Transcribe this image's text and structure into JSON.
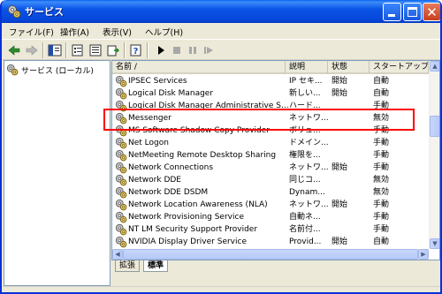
{
  "window": {
    "title": "サービス",
    "accent": "#0b54e5",
    "close_color": "#c7401b"
  },
  "menu": [
    {
      "label": "ファイル(F)"
    },
    {
      "label": "操作(A)"
    },
    {
      "label": "表示(V)"
    },
    {
      "label": "ヘルプ(H)"
    }
  ],
  "toolbar": {
    "icons": [
      "back-arrow-icon",
      "forward-arrow-icon",
      "console-tree-icon",
      "properties-icon",
      "export-list-icon",
      "help-icon",
      "start-service-icon",
      "stop-service-icon",
      "pause-service-icon",
      "restart-service-icon"
    ]
  },
  "tree": {
    "root_label": "サービス (ローカル)"
  },
  "table": {
    "columns": [
      "名前 /",
      "説明",
      "状態",
      "スタートアップの種類"
    ],
    "rows": [
      {
        "name": "IPSEC Services",
        "desc": "IP セキ...",
        "state": "開始",
        "startup": "自動"
      },
      {
        "name": "Logical Disk Manager",
        "desc": "新しい...",
        "state": "開始",
        "startup": "自動"
      },
      {
        "name": "Logical Disk Manager Administrative S...",
        "desc": "ハード...",
        "state": "",
        "startup": "手動"
      },
      {
        "name": "Messenger",
        "desc": "ネットワ...",
        "state": "",
        "startup": "無効"
      },
      {
        "name": "MS Software Shadow Copy Provider",
        "desc": "ボリュ...",
        "state": "",
        "startup": "手動"
      },
      {
        "name": "Net Logon",
        "desc": "ドメイン...",
        "state": "",
        "startup": "手動"
      },
      {
        "name": "NetMeeting Remote Desktop Sharing",
        "desc": "権限を...",
        "state": "",
        "startup": "手動"
      },
      {
        "name": "Network Connections",
        "desc": "ネットワ...",
        "state": "開始",
        "startup": "手動"
      },
      {
        "name": "Network DDE",
        "desc": "同じコ...",
        "state": "",
        "startup": "無効"
      },
      {
        "name": "Network DDE DSDM",
        "desc": "Dynam...",
        "state": "",
        "startup": "無効"
      },
      {
        "name": "Network Location Awareness (NLA)",
        "desc": "ネットワ...",
        "state": "開始",
        "startup": "手動"
      },
      {
        "name": "Network Provisioning Service",
        "desc": "自動ネ...",
        "state": "",
        "startup": "手動"
      },
      {
        "name": "NT LM Security Support Provider",
        "desc": "名前付...",
        "state": "",
        "startup": "手動"
      },
      {
        "name": "NVIDIA Display Driver Service",
        "desc": "Provid...",
        "state": "開始",
        "startup": "自動"
      }
    ]
  },
  "tabs": [
    {
      "label": "拡張"
    },
    {
      "label": "標準"
    }
  ],
  "highlight_color": "#ff0000"
}
